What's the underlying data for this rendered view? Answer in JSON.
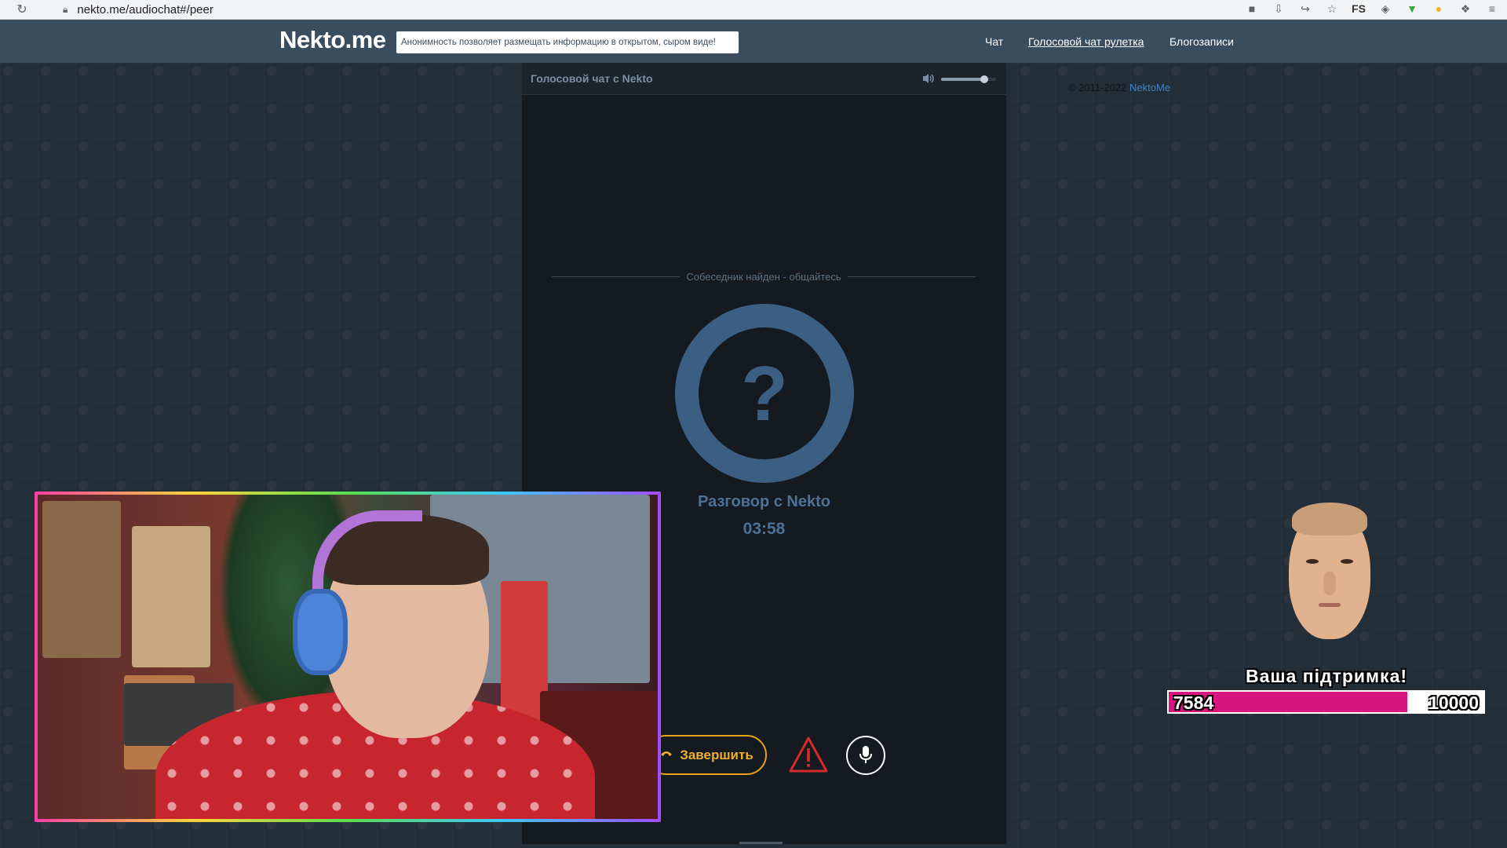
{
  "browser": {
    "url": "nekto.me/audiochat#/peer",
    "reload_icon": "reload-icon",
    "lock_icon": "lock-icon",
    "extension_icons": [
      "camera-icon",
      "install-icon",
      "share-icon",
      "star-icon",
      "fs-extension-icon",
      "shield-extension-icon",
      "download-extension-icon",
      "circle-extension-icon",
      "puzzle-icon",
      "reading-list-icon"
    ],
    "fs_label": "FS"
  },
  "header": {
    "logo": "Nekto.me",
    "notice": "Анонимность позволяет размещать информацию в открытом, сыром виде!",
    "nav": [
      {
        "label": "Чат",
        "active": false
      },
      {
        "label": "Голосовой чат рулетка",
        "active": true
      },
      {
        "label": "Блогозаписи",
        "active": false
      }
    ]
  },
  "chat": {
    "title": "Голосовой чат с Nekto",
    "volume_level": 0.78,
    "status": "Собеседник найден - общайтесь",
    "avatar_symbol": "?",
    "peer_label": "Разговор с Nekto",
    "timer": "03:58",
    "end_button_label": "Завершить",
    "report_icon": "warning-triangle-icon",
    "mic_icon": "microphone-icon"
  },
  "footer": {
    "copyright_prefix": "© 2011-2022",
    "copyright_link": "NektoMe"
  },
  "support_widget": {
    "title": "Ваша підтримка!",
    "current": "7584",
    "goal": "10000",
    "progress_fraction": 0.7584,
    "fill_color": "#d8177e"
  },
  "colors": {
    "header_bg": "#3a4d5e",
    "panel_bg": "#141a20",
    "accent_orange": "#e8a31a",
    "avatar_blue": "#3b5f82",
    "report_red": "#d62b2b"
  }
}
